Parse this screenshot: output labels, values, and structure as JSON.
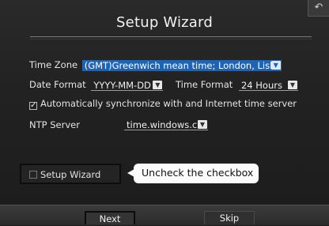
{
  "window": {
    "title": "Setup Wizard",
    "back_icon": "back-arrow-icon"
  },
  "form": {
    "time_zone": {
      "label": "Time Zone",
      "value": "(GMT)Greenwich mean time; London, Lisbo"
    },
    "date_format": {
      "label": "Date Format",
      "value": "YYYY-MM-DD"
    },
    "time_format": {
      "label": "Time Format",
      "value": "24 Hours"
    },
    "auto_sync": {
      "checked": true,
      "label": "Automatically synchronize with and Internet time server"
    },
    "ntp_server": {
      "label": "NTP Server",
      "value": "time.windows.c"
    }
  },
  "setup_wizard_checkbox": {
    "checked": false,
    "label": "Setup Wizard"
  },
  "callout": {
    "text": "Uncheck the checkbox"
  },
  "footer": {
    "next_label": "Next",
    "skip_label": "Skip"
  },
  "colors": {
    "highlight": "#1f63b4",
    "background": "#222222"
  }
}
